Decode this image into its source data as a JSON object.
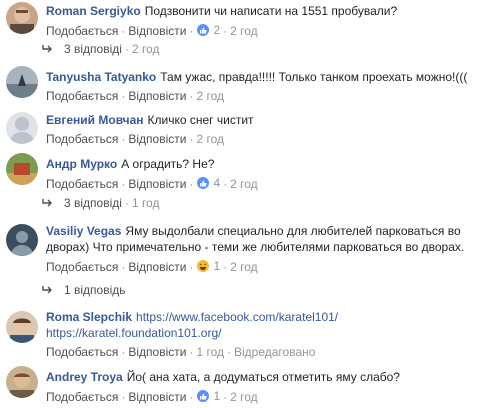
{
  "comments": [
    {
      "author": "Roman Sergiyko",
      "text": "Подзвонити чи написати на 1551 пробували?",
      "like": "Подобається",
      "reply": "Відповісти",
      "reactions": "2",
      "time": "2 год",
      "replies": "3 відповіді",
      "replies_time": "2 год"
    },
    {
      "author": "Tanyusha Tatyanko",
      "text": "Там ужас, правда!!!!! Только танком проехать можно!(((",
      "like": "Подобається",
      "reply": "Відповісти",
      "time": "2 год"
    },
    {
      "author": "Евгений Мовчан",
      "text": "Кличко снег чистит",
      "like": "Подобається",
      "reply": "Відповісти",
      "time": "2 год"
    },
    {
      "author": "Андр Мурко",
      "text": "А оградить? Не?",
      "like": "Подобається",
      "reply": "Відповісти",
      "reactions": "4",
      "time": "2 год",
      "replies": "3 відповіді",
      "replies_time": "1 год"
    },
    {
      "author": "Vasiliy Vegas",
      "text": "Яму выдолбали специально для любителей парковаться во",
      "text2": "дворах) Что примечательно - теми же любителями парковаться во дворах.",
      "like": "Подобається",
      "reply": "Відповісти",
      "reactions": "1",
      "time": "2 год",
      "replies": "1 відповідь"
    },
    {
      "author": "Roma Slepchik",
      "text": "https://www.facebook.com/karatel101/",
      "text2": "https://karatel.foundation101.org/",
      "like": "Подобається",
      "reply": "Відповісти",
      "time": "1 год",
      "edited": "Відредаговано"
    },
    {
      "author": "Andrey Troya",
      "text": "Йо( ана хата, а додуматься отметить яму слабо?",
      "like": "Подобається",
      "reply": "Відповісти",
      "reactions": "1",
      "time": "2 год"
    }
  ],
  "colors": {
    "link": "#385898",
    "meta": "#90949c",
    "text": "#1d2129",
    "like_blue": "#5890ff",
    "haha_yellow": "#f7b928"
  }
}
